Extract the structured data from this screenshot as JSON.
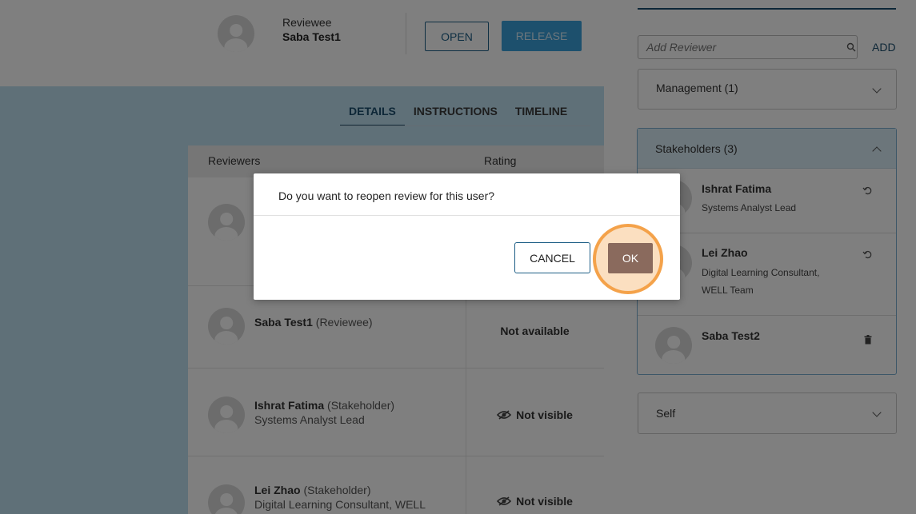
{
  "header": {
    "reviewee_label": "Reviewee",
    "reviewee_name": "Saba Test1",
    "open_label": "OPEN",
    "release_label": "RELEASE"
  },
  "tabs": [
    {
      "label": "DETAILS",
      "active": true
    },
    {
      "label": "INSTRUCTIONS",
      "active": false
    },
    {
      "label": "TIMELINE",
      "active": false
    }
  ],
  "table": {
    "col_reviewers": "Reviewers",
    "col_rating": "Rating",
    "rows": [
      {
        "name": "Saba Test1",
        "role": "(Reviewee)",
        "subtitle": "",
        "rating": "Not available"
      },
      {
        "name": "Ishrat Fatima",
        "role": "(Stakeholder)",
        "subtitle": "Systems Analyst Lead",
        "rating": "Not visible"
      },
      {
        "name": "Lei Zhao",
        "role": "(Stakeholder)",
        "subtitle": "Digital Learning Consultant, WELL",
        "rating": "Not visible"
      }
    ]
  },
  "sidebar": {
    "add_placeholder": "Add Reviewer",
    "add_label": "ADD",
    "sections": {
      "management": "Management (1)",
      "stakeholders": "Stakeholders (3)",
      "self": "Self"
    },
    "stakeholders": [
      {
        "name": "Ishrat Fatima",
        "line1": "Systems Analyst Lead",
        "line2": "",
        "action": "undo-icon"
      },
      {
        "name": "Lei Zhao",
        "line1": "Digital Learning Consultant,",
        "line2": "WELL Team",
        "action": "undo-icon"
      },
      {
        "name": "Saba Test2",
        "line1": "",
        "line2": "",
        "action": "trash-icon"
      }
    ]
  },
  "dialog": {
    "message": "Do you want to reopen review for this user?",
    "cancel_label": "CANCEL",
    "ok_label": "OK"
  },
  "colors": {
    "brand": "#1c4f6e",
    "release": "#3ba0db",
    "highlight": "#f4a24a"
  }
}
